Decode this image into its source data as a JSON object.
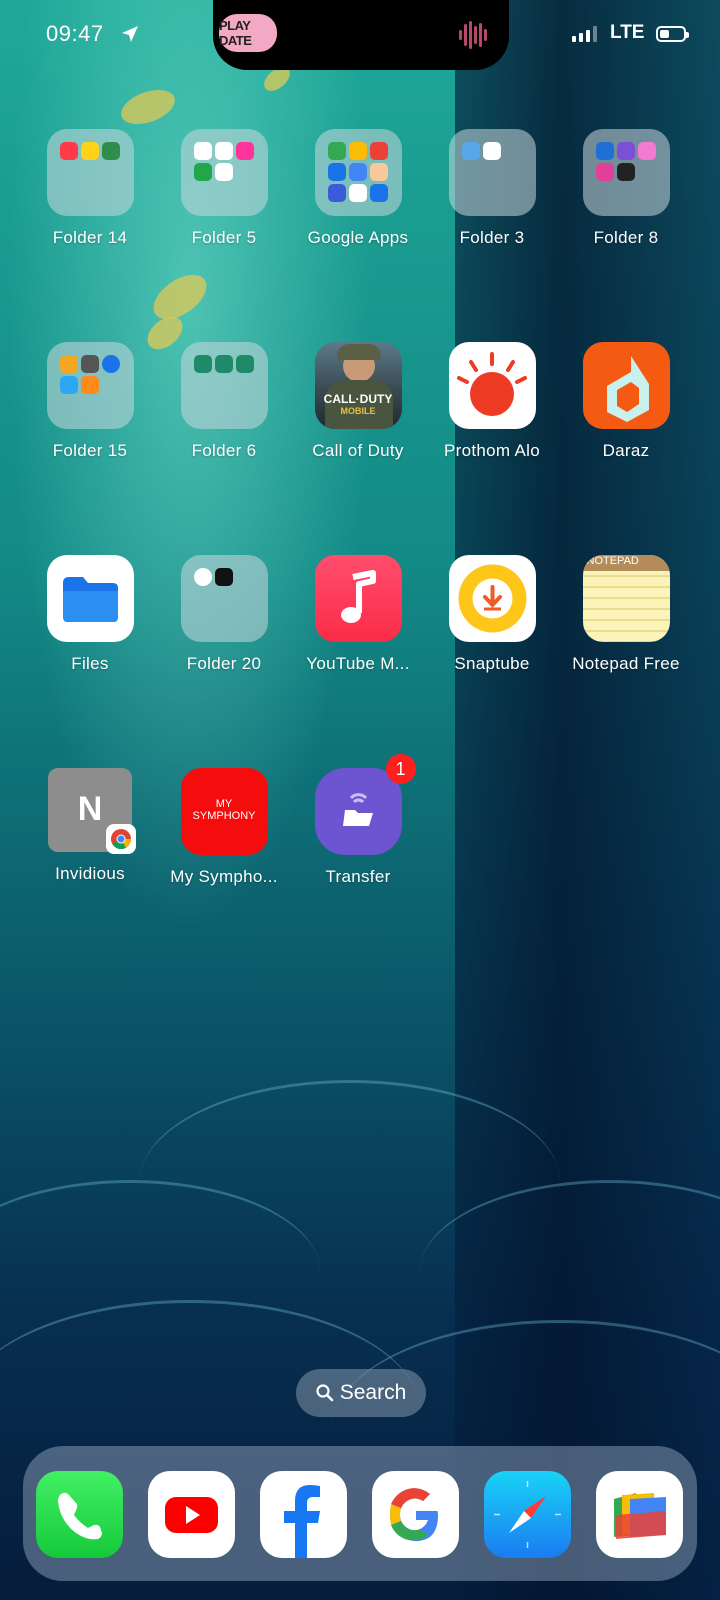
{
  "status_bar": {
    "time": "09:47",
    "network": "LTE",
    "live_activity_label": "PLAY DATE"
  },
  "apps": [
    {
      "label": "Folder 14",
      "type": "folder",
      "icon": "folder-icon"
    },
    {
      "label": "Folder 5",
      "type": "folder",
      "icon": "folder-icon"
    },
    {
      "label": "Google Apps",
      "type": "folder",
      "icon": "folder-icon"
    },
    {
      "label": "Folder 3",
      "type": "folder",
      "icon": "folder-icon"
    },
    {
      "label": "Folder 8",
      "type": "folder",
      "icon": "folder-icon"
    },
    {
      "label": "Folder 15",
      "type": "folder",
      "icon": "folder-icon"
    },
    {
      "label": "Folder 6",
      "type": "folder",
      "icon": "folder-icon"
    },
    {
      "label": "Call of Duty",
      "type": "app",
      "icon": "call-of-duty-icon",
      "icon_text": "CALL·DUTY",
      "icon_subtext": "MOBILE"
    },
    {
      "label": "Prothom Alo",
      "type": "app",
      "icon": "prothom-alo-icon"
    },
    {
      "label": "Daraz",
      "type": "app",
      "icon": "daraz-icon"
    },
    {
      "label": "Files",
      "type": "app",
      "icon": "files-icon"
    },
    {
      "label": "Folder 20",
      "type": "folder",
      "icon": "folder-icon"
    },
    {
      "label": "YouTube M...",
      "type": "app",
      "icon": "youtube-music-icon"
    },
    {
      "label": "Snaptube",
      "type": "app",
      "icon": "snaptube-icon"
    },
    {
      "label": "Notepad Free",
      "type": "app",
      "icon": "notepad-icon",
      "icon_text": "NOTEPAD"
    },
    {
      "label": "Invidious",
      "type": "app",
      "icon": "invidious-icon",
      "icon_text": "N"
    },
    {
      "label": "My Sympho...",
      "type": "app",
      "icon": "my-symphony-icon",
      "icon_text": "MY",
      "icon_subtext": "SYMPHONY"
    },
    {
      "label": "Transfer",
      "type": "app",
      "icon": "transfer-icon",
      "badge": "1"
    }
  ],
  "search": {
    "label": "Search"
  },
  "dock": [
    {
      "name": "phone",
      "icon": "phone-icon",
      "color": "#2bd94a"
    },
    {
      "name": "youtube",
      "icon": "youtube-icon",
      "color": "#ffffff"
    },
    {
      "name": "facebook",
      "icon": "facebook-icon",
      "color": "#ffffff"
    },
    {
      "name": "google",
      "icon": "google-icon",
      "color": "#ffffff"
    },
    {
      "name": "safari",
      "icon": "safari-icon",
      "color": "#1aa3f5"
    },
    {
      "name": "files-go",
      "icon": "files-go-icon",
      "color": "#ffffff"
    }
  ]
}
